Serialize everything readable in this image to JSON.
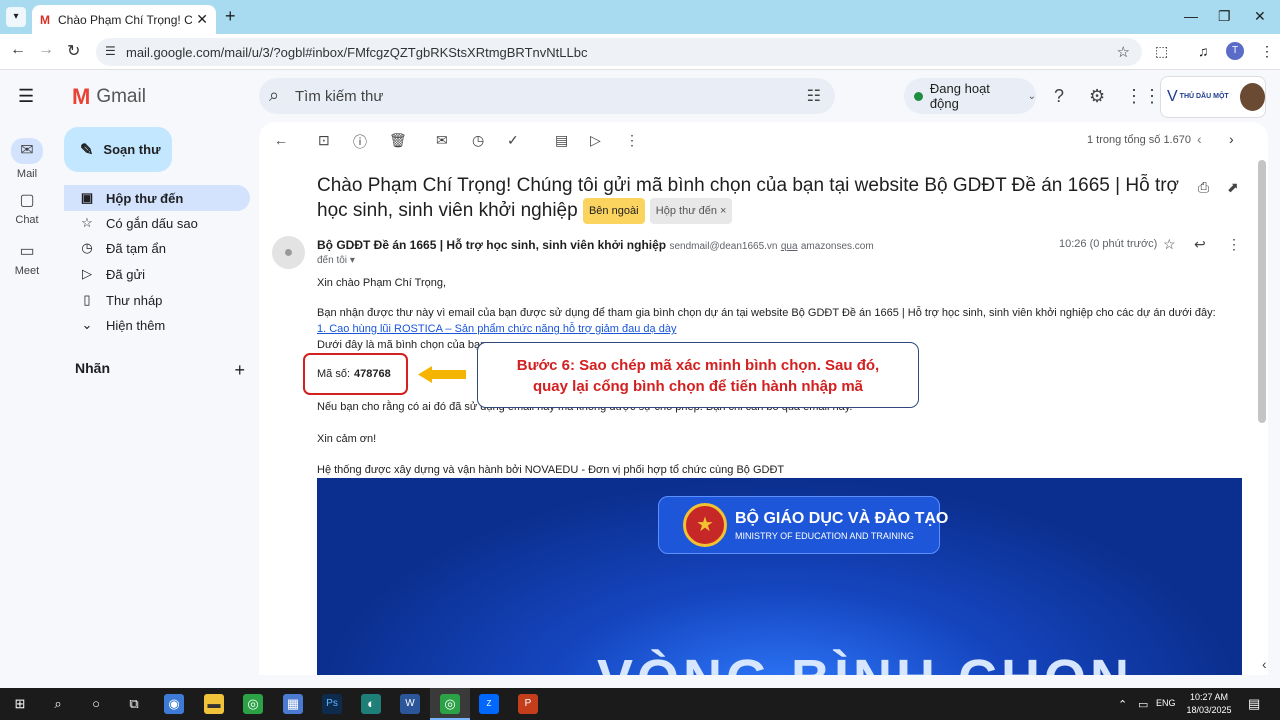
{
  "browser": {
    "tab_title": "Chào Phạm Chí Trọng! Chúng tôi",
    "tab_favicon": "M",
    "url": "mail.google.com/mail/u/3/?ogbl#inbox/FMfcgzQZTgbRKStsXRtmgBRTnvNtLLbc",
    "profile_initial": "T"
  },
  "gmail": {
    "logo_text": "Gmail",
    "search_placeholder": "Tìm kiếm thư",
    "status_label": "Đang hoạt động",
    "account_org": "THỦ DẦU MỘT"
  },
  "rail": [
    {
      "label": "Mail"
    },
    {
      "label": "Chat"
    },
    {
      "label": "Meet"
    }
  ],
  "nav": {
    "compose": "Soạn thư",
    "items": [
      {
        "label": "Hộp thư đến"
      },
      {
        "label": "Có gắn dấu sao"
      },
      {
        "label": "Đã tạm ẩn"
      },
      {
        "label": "Đã gửi"
      },
      {
        "label": "Thư nháp"
      },
      {
        "label": "Hiện thêm"
      }
    ],
    "labels_heading": "Nhãn"
  },
  "email": {
    "pager": "1 trong tổng số 1.670",
    "subject": "Chào Phạm Chí Trọng! Chúng tôi gửi mã bình chọn của bạn tại website Bộ GDĐT Đề án 1665 | Hỗ trợ học sinh, sinh viên khởi nghiệp",
    "badge_external": "Bên ngoài",
    "badge_inbox": "Hộp thư đến",
    "badge_inbox_close": "×",
    "sender_name": "Bộ GDĐT Đề án 1665 | Hỗ trợ học sinh, sinh viên khởi nghiệp",
    "sender_addr": "sendmail@dean1665.vn",
    "via_word": "qua",
    "via_domain": "amazonses.com",
    "to_me": "đến tôi",
    "time": "10:26 (0 phút trước)",
    "greeting": "Xin chào Phạm Chí Trọng,",
    "para1": "Bạn nhận được thư này vì email của bạn được sử dụng để tham gia bình chọn dự án tại website Bộ GDĐT Đề án 1665 | Hỗ trợ học sinh, sinh viên khởi nghiệp cho các dự án dưới đây:",
    "project_link": "1. Cao hùng lũi ROSTICA – Sản phẩm chức năng hỗ trợ giảm đau dạ dày",
    "code_intro": "Dưới đây là mã bình chọn của bạn:",
    "code_label": "Mã số:",
    "code_value": "478768",
    "para2": "Nếu bạn cho rằng có ai đó đã sử dụng email này mà không được sự cho phép. Bạn chỉ cần bỏ qua email này.",
    "thanks": "Xin cảm ơn!",
    "footer": "Hệ thống được xây dựng và vận hành bởi NOVAEDU - Đơn vị phối hợp tổ chức cùng Bộ GDĐT",
    "banner_title": "BỘ GIÁO DỤC VÀ ĐÀO TẠO",
    "banner_subtitle": "MINISTRY OF EDUCATION AND TRAINING",
    "banner_big": "VÒNG BÌNH CHỌN"
  },
  "callout": {
    "line1": "Bước 6: Sao chép mã xác minh bình chọn. Sau đó,",
    "line2": "quay lại cổng bình chọn để tiến hành nhập mã"
  },
  "taskbar": {
    "lang": "ENG",
    "time": "10:27 AM",
    "date": "18/03/2025"
  },
  "colors": {
    "compose_bg": "#c2e7ff",
    "active_nav": "#d3e3fd",
    "callout_text": "#d32020",
    "arrow": "#f5b400"
  }
}
